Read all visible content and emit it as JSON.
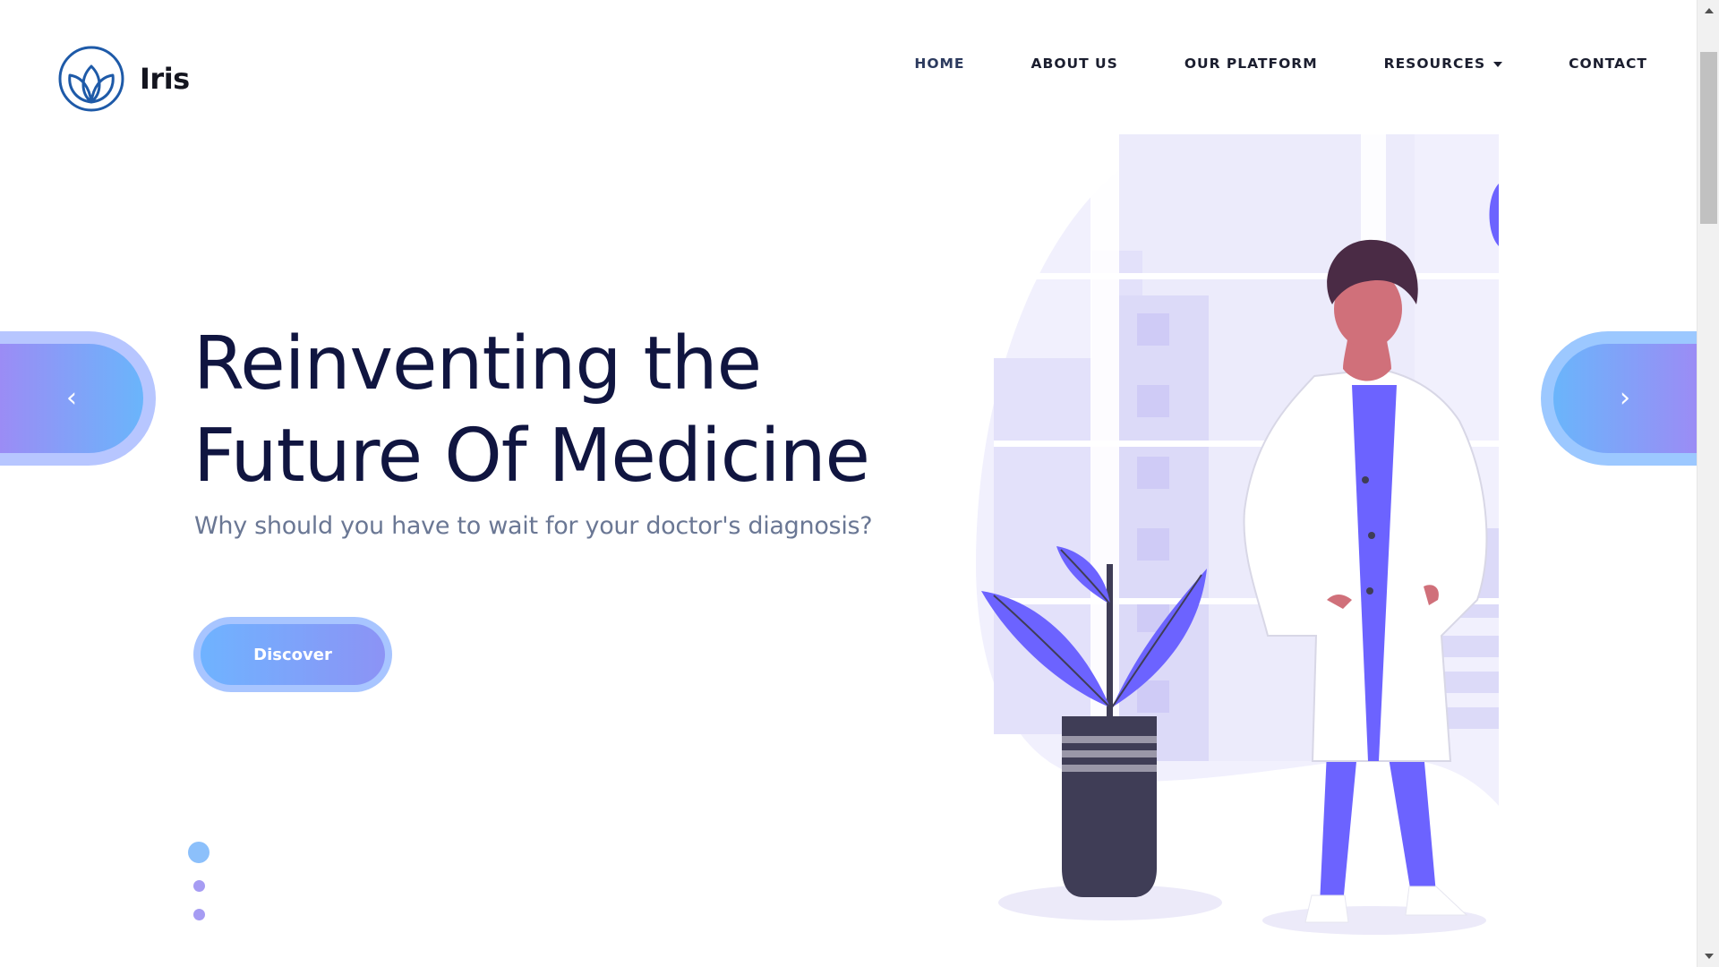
{
  "brand": {
    "name": "Iris",
    "logo_icon": "lotus-icon",
    "color": "#1e5aa8"
  },
  "nav": {
    "items": [
      {
        "label": "HOME",
        "active": true
      },
      {
        "label": "ABOUT US"
      },
      {
        "label": "OUR PLATFORM"
      },
      {
        "label": "RESOURCES",
        "has_dropdown": true,
        "dropdown_icon": "caret-down-icon"
      },
      {
        "label": "CONTACT"
      }
    ]
  },
  "hero": {
    "title_line1": "Reinventing the",
    "title_line2": "Future Of Medicine",
    "subtitle": "Why should you have to wait for your doctor's diagnosis?",
    "cta_label": "Discover",
    "illustration": "doctor-with-plant-illustration"
  },
  "carousel": {
    "prev_icon": "chevron-left-icon",
    "next_icon": "chevron-right-icon",
    "prev_glyph": "‹",
    "next_glyph": "›",
    "slides": 3,
    "active_slide": 1
  },
  "colors": {
    "heading": "#101540",
    "subtitle": "#6a7794",
    "accent_blue": "#6fb3ff",
    "accent_purple": "#8c93f5",
    "illustration_purple": "#6c63ff"
  }
}
